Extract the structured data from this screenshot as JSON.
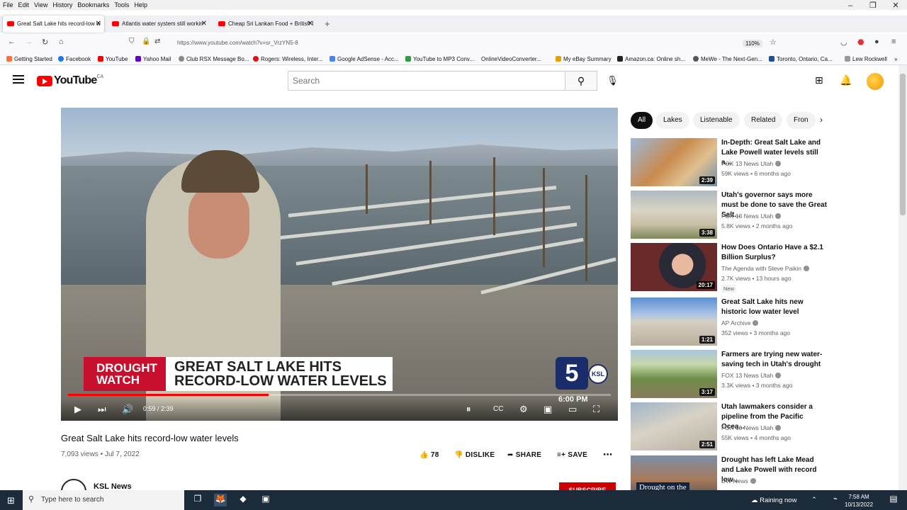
{
  "menubar": {
    "items": [
      "File",
      "Edit",
      "View",
      "History",
      "Bookmarks",
      "Tools",
      "Help"
    ]
  },
  "tabs": [
    {
      "label": "Great Salt Lake hits record-low w"
    },
    {
      "label": "Atlantis water system still workin"
    },
    {
      "label": "Cheap Sri Lankan Food + British I"
    }
  ],
  "address": {
    "url": "https://www.youtube.com/watch?v=sr_VrzYN5-8",
    "zoom": "110%"
  },
  "bookmarks": [
    "Getting Started",
    "Facebook",
    "YouTube",
    "Yahoo Mail",
    "Club RSX Message Bo...",
    "Rogers: Wireless, Inter...",
    "Google AdSense - Acc...",
    "YouTube to MP3 Conv...",
    "OnlineVideoConverter...",
    "My eBay Summary",
    "Amazon.ca: Online sh...",
    "MeWe - The Next-Gen...",
    "Toronto, Ontario, Ca...",
    "Lew Rockwell"
  ],
  "youtube": {
    "logo_text": "YouTube",
    "region": "CA",
    "search_placeholder": "Search"
  },
  "player": {
    "banner_left": "DROUGHT WATCH",
    "banner_headline_1": "GREAT SALT LAKE HITS",
    "banner_headline_2": "RECORD-LOW WATER LEVELS",
    "channel_logo": "5",
    "channel_mark": "KSL",
    "broadcast_time": "6:00 PM",
    "current_time": "0:59",
    "duration": "2:39",
    "time_display": "0:59 / 2:39",
    "progress": 0.37
  },
  "video": {
    "title": "Great Salt Lake hits record-low water levels",
    "meta": "7,093 views • Jul 7, 2022",
    "likes": "78",
    "dislike_label": "DISLIKE",
    "share_label": "SHARE",
    "save_label": "SAVE",
    "channel": "KSL News",
    "subscribe_label": "SUBSCRIBE"
  },
  "chips": [
    "All",
    "Lakes",
    "Listenable",
    "Related",
    "Fron"
  ],
  "recommendations": [
    {
      "title": "In-Depth: Great Salt Lake and Lake Powell water levels still a...",
      "channel": "FOX 13 News Utah",
      "meta": "59K views • 6 months ago",
      "duration": "2:39"
    },
    {
      "title": "Utah's governor says more must be done to save the Great Salt...",
      "channel": "FOX 13 News Utah",
      "meta": "5.8K views • 2 months ago",
      "duration": "3:38"
    },
    {
      "title": "How Does Ontario Have a $2.1 Billion Surplus?",
      "channel": "The Agenda with Steve Paikin",
      "meta": "2.7K views • 13 hours ago",
      "duration": "20:17",
      "badge": "New"
    },
    {
      "title": "Great Salt Lake hits new historic low water level",
      "channel": "AP Archive",
      "meta": "352 views • 3 months ago",
      "duration": "1:21"
    },
    {
      "title": "Farmers are trying new water-saving tech in Utah's drought",
      "channel": "FOX 13 News Utah",
      "meta": "3.3K views • 3 months ago",
      "duration": "3:17"
    },
    {
      "title": "Utah lawmakers consider a pipeline from the Pacific Ocea...",
      "channel": "FOX 13 News Utah",
      "meta": "55K views • 4 months ago",
      "duration": "2:51"
    },
    {
      "title": "Drought has left Lake Mead and Lake Powell with record low...",
      "channel": "DW News",
      "meta": "",
      "duration": "",
      "thumb_text": "Drought on the"
    }
  ],
  "taskbar": {
    "search_placeholder": "Type here to search",
    "weather": "Raining now",
    "time": "7:58 AM",
    "date": "10/13/2022"
  },
  "colors": {
    "youtube_red": "#ff0000",
    "subscribe_red": "#cc0000",
    "drought_red": "#c8102e",
    "ksl_blue": "#1b2c6b"
  }
}
